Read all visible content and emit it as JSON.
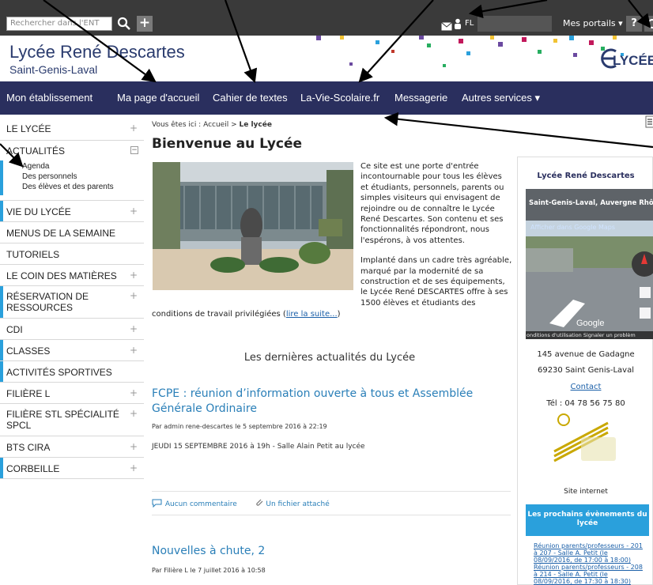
{
  "topbar": {
    "search_placeholder": "Rechercher dans l'ENT",
    "plus_label": "+",
    "user_initials": "FL",
    "portals_label": "Mes portails ▾",
    "help_label": "?"
  },
  "banner": {
    "title": "Lycée René Descartes",
    "subtitle": "Saint-Genis-Laval",
    "logo_text": "LYCÉE"
  },
  "nav": {
    "items": [
      "Mon établissement",
      "Ma page d'accueil",
      "Cahier de textes",
      "La-Vie-Scolaire.fr",
      "Messagerie",
      "Autres services ▾"
    ]
  },
  "sidebar": {
    "items": [
      {
        "label": "LE LYCÉE",
        "toggle": "+"
      },
      {
        "label": "ACTUALITÉS",
        "toggle": "−"
      },
      {
        "label": "VIE DU LYCÉE",
        "toggle": "+"
      },
      {
        "label": "MENUS DE LA SEMAINE",
        "toggle": ""
      },
      {
        "label": "TUTORIELS",
        "toggle": ""
      },
      {
        "label": "LE COIN DES MATIÈRES",
        "toggle": "+"
      },
      {
        "label": "RÉSERVATION DE",
        "label2": "RESSOURCES",
        "toggle": "+"
      },
      {
        "label": "CDI",
        "toggle": "+"
      },
      {
        "label": "CLASSES",
        "toggle": "+"
      },
      {
        "label": "ACTIVITÉS SPORTIVES",
        "toggle": ""
      },
      {
        "label": "FILIÈRE L",
        "toggle": "+"
      },
      {
        "label": "FILIÈRE STL SPÉCIALITÉ",
        "label2": "SPCL",
        "toggle": "+"
      },
      {
        "label": "BTS CIRA",
        "toggle": "+"
      },
      {
        "label": "CORBEILLE",
        "toggle": "+"
      }
    ],
    "subitems": [
      "Agenda",
      "Des personnels",
      "Des élèves et des parents"
    ]
  },
  "content": {
    "breadcrumb_prefix": "Vous êtes ici : Accueil > ",
    "breadcrumb_current": "Le lycée",
    "title": "Bienvenue au Lycée",
    "intro_p1": "Ce site est une porte d'entrée incontournable pour tous les élèves et étudiants, personnels, parents ou simples visiteurs qui envisagent de rejoindre ou de connaître le Lycée René Descartes. Son contenu et ses fonctionnalités répondront, nous l'espérons, à vos attentes.",
    "intro_p2": "Implanté dans un cadre très agréable, marqué par la modernité de sa construction et de ses équipements, le Lycée René DESCARTES offre à ses 1500 élèves et étudiants des",
    "intro_cont": "conditions de travail privilégiées (",
    "read_more": "lire la suite...",
    "intro_close": ")",
    "news_heading": "Les dernières actualités du Lycée",
    "news": [
      {
        "title": "FCPE : réunion d’information ouverte à tous et Assemblée Générale Ordinaire",
        "meta": "Par admin rene-descartes le 5 septembre 2016 à 22:19",
        "text": "JEUDI 15 SEPTEMBRE 2016 à 19h - Salle Alain Petit au lycée",
        "comments": "Aucun commentaire",
        "attachment": "Un fichier attaché"
      },
      {
        "title": "Nouvelles à chute, 2",
        "meta": "Par Filière L le 7 juillet 2016 à 10:58"
      }
    ]
  },
  "rightcol": {
    "title": "Lycée René Descartes",
    "map_place": "Saint-Genis-Laval, Auvergne Rhône",
    "map_link": "Afficher dans Google Maps",
    "map_brand": "Google",
    "map_footer": "onditions d'utilisation  Signaler un problèm",
    "address1": "145 avenue de Gadagne",
    "address2": "69230 Saint Genis-Laval",
    "contact": "Contact",
    "phone": "Tél : 04 78 56 75 80",
    "site_label": "Site internet",
    "events_title": "Les prochains évènements du lycée",
    "events": [
      "Réunion parents/professeurs - 201",
      "à 207 - Salle A. Petit (le",
      "08/09/2016, de 17:00 à 18:00)",
      "Réunion parents/professeurs - 208",
      "à 214 - Salle A. Petit (le",
      "08/09/2016, de 17:30 à 18:30)"
    ]
  },
  "colors": {
    "nav_bg": "#2a2f5e",
    "topbar_bg": "#3a3a3a",
    "accent": "#2aa0dc",
    "link": "#2a7fb8"
  }
}
